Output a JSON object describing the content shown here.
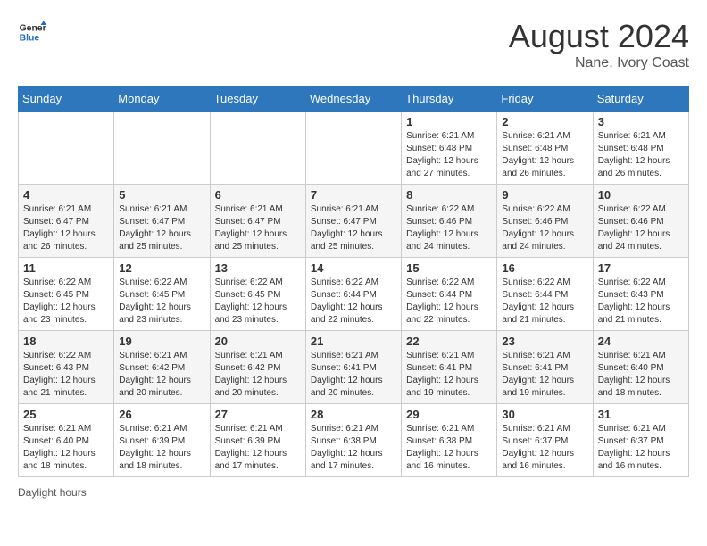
{
  "header": {
    "logo_general": "General",
    "logo_blue": "Blue",
    "main_title": "August 2024",
    "subtitle": "Nane, Ivory Coast"
  },
  "calendar": {
    "days_of_week": [
      "Sunday",
      "Monday",
      "Tuesday",
      "Wednesday",
      "Thursday",
      "Friday",
      "Saturday"
    ],
    "weeks": [
      [
        {
          "day": "",
          "info": ""
        },
        {
          "day": "",
          "info": ""
        },
        {
          "day": "",
          "info": ""
        },
        {
          "day": "",
          "info": ""
        },
        {
          "day": "1",
          "info": "Sunrise: 6:21 AM\nSunset: 6:48 PM\nDaylight: 12 hours and 27 minutes."
        },
        {
          "day": "2",
          "info": "Sunrise: 6:21 AM\nSunset: 6:48 PM\nDaylight: 12 hours and 26 minutes."
        },
        {
          "day": "3",
          "info": "Sunrise: 6:21 AM\nSunset: 6:48 PM\nDaylight: 12 hours and 26 minutes."
        }
      ],
      [
        {
          "day": "4",
          "info": "Sunrise: 6:21 AM\nSunset: 6:47 PM\nDaylight: 12 hours and 26 minutes."
        },
        {
          "day": "5",
          "info": "Sunrise: 6:21 AM\nSunset: 6:47 PM\nDaylight: 12 hours and 25 minutes."
        },
        {
          "day": "6",
          "info": "Sunrise: 6:21 AM\nSunset: 6:47 PM\nDaylight: 12 hours and 25 minutes."
        },
        {
          "day": "7",
          "info": "Sunrise: 6:21 AM\nSunset: 6:47 PM\nDaylight: 12 hours and 25 minutes."
        },
        {
          "day": "8",
          "info": "Sunrise: 6:22 AM\nSunset: 6:46 PM\nDaylight: 12 hours and 24 minutes."
        },
        {
          "day": "9",
          "info": "Sunrise: 6:22 AM\nSunset: 6:46 PM\nDaylight: 12 hours and 24 minutes."
        },
        {
          "day": "10",
          "info": "Sunrise: 6:22 AM\nSunset: 6:46 PM\nDaylight: 12 hours and 24 minutes."
        }
      ],
      [
        {
          "day": "11",
          "info": "Sunrise: 6:22 AM\nSunset: 6:45 PM\nDaylight: 12 hours and 23 minutes."
        },
        {
          "day": "12",
          "info": "Sunrise: 6:22 AM\nSunset: 6:45 PM\nDaylight: 12 hours and 23 minutes."
        },
        {
          "day": "13",
          "info": "Sunrise: 6:22 AM\nSunset: 6:45 PM\nDaylight: 12 hours and 23 minutes."
        },
        {
          "day": "14",
          "info": "Sunrise: 6:22 AM\nSunset: 6:44 PM\nDaylight: 12 hours and 22 minutes."
        },
        {
          "day": "15",
          "info": "Sunrise: 6:22 AM\nSunset: 6:44 PM\nDaylight: 12 hours and 22 minutes."
        },
        {
          "day": "16",
          "info": "Sunrise: 6:22 AM\nSunset: 6:44 PM\nDaylight: 12 hours and 21 minutes."
        },
        {
          "day": "17",
          "info": "Sunrise: 6:22 AM\nSunset: 6:43 PM\nDaylight: 12 hours and 21 minutes."
        }
      ],
      [
        {
          "day": "18",
          "info": "Sunrise: 6:22 AM\nSunset: 6:43 PM\nDaylight: 12 hours and 21 minutes."
        },
        {
          "day": "19",
          "info": "Sunrise: 6:21 AM\nSunset: 6:42 PM\nDaylight: 12 hours and 20 minutes."
        },
        {
          "day": "20",
          "info": "Sunrise: 6:21 AM\nSunset: 6:42 PM\nDaylight: 12 hours and 20 minutes."
        },
        {
          "day": "21",
          "info": "Sunrise: 6:21 AM\nSunset: 6:41 PM\nDaylight: 12 hours and 20 minutes."
        },
        {
          "day": "22",
          "info": "Sunrise: 6:21 AM\nSunset: 6:41 PM\nDaylight: 12 hours and 19 minutes."
        },
        {
          "day": "23",
          "info": "Sunrise: 6:21 AM\nSunset: 6:41 PM\nDaylight: 12 hours and 19 minutes."
        },
        {
          "day": "24",
          "info": "Sunrise: 6:21 AM\nSunset: 6:40 PM\nDaylight: 12 hours and 18 minutes."
        }
      ],
      [
        {
          "day": "25",
          "info": "Sunrise: 6:21 AM\nSunset: 6:40 PM\nDaylight: 12 hours and 18 minutes."
        },
        {
          "day": "26",
          "info": "Sunrise: 6:21 AM\nSunset: 6:39 PM\nDaylight: 12 hours and 18 minutes."
        },
        {
          "day": "27",
          "info": "Sunrise: 6:21 AM\nSunset: 6:39 PM\nDaylight: 12 hours and 17 minutes."
        },
        {
          "day": "28",
          "info": "Sunrise: 6:21 AM\nSunset: 6:38 PM\nDaylight: 12 hours and 17 minutes."
        },
        {
          "day": "29",
          "info": "Sunrise: 6:21 AM\nSunset: 6:38 PM\nDaylight: 12 hours and 16 minutes."
        },
        {
          "day": "30",
          "info": "Sunrise: 6:21 AM\nSunset: 6:37 PM\nDaylight: 12 hours and 16 minutes."
        },
        {
          "day": "31",
          "info": "Sunrise: 6:21 AM\nSunset: 6:37 PM\nDaylight: 12 hours and 16 minutes."
        }
      ]
    ]
  },
  "footer": {
    "daylight_hours_label": "Daylight hours"
  }
}
